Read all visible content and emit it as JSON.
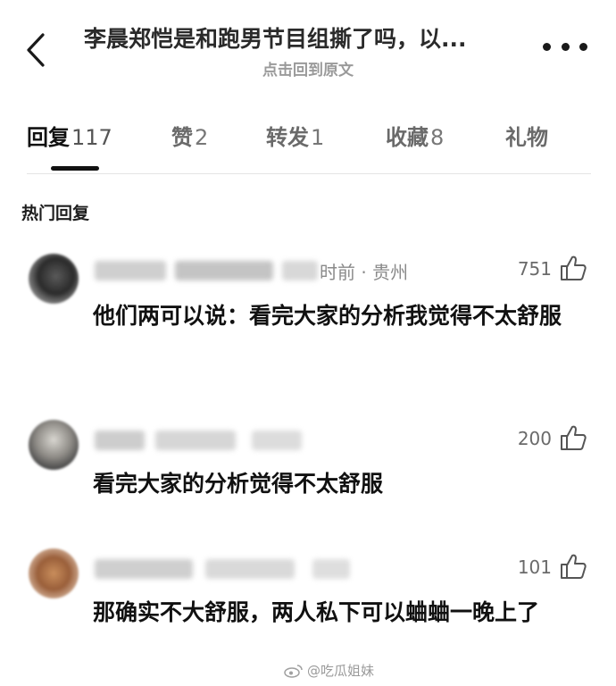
{
  "header": {
    "title": "李晨郑恺是和跑男节目组撕了吗，以...",
    "subtitle": "点击回到原文"
  },
  "tabs": [
    {
      "label": "回复",
      "count": "117",
      "active": true
    },
    {
      "label": "赞",
      "count": "2",
      "active": false
    },
    {
      "label": "转发",
      "count": "1",
      "active": false
    },
    {
      "label": "收藏",
      "count": "8",
      "active": false
    },
    {
      "label": "礼物",
      "count": "",
      "active": false
    }
  ],
  "section_title": "热门回复",
  "comments": [
    {
      "meta": "时前 · 贵州",
      "likes": "751",
      "text": "他们两可以说：看完大家的分析我觉得不太舒服"
    },
    {
      "meta": "",
      "likes": "200",
      "text": "看完大家的分析觉得不太舒服"
    },
    {
      "meta": "",
      "likes": "101",
      "text": "那确实不大舒服，两人私下可以蛐蛐一晚上了"
    }
  ],
  "watermark": "@吃瓜姐妹",
  "icons": {
    "back": "chevron-left-icon",
    "more": "more-dots-icon",
    "like": "thumb-up-icon",
    "watermark": "weibo-logo-icon"
  }
}
